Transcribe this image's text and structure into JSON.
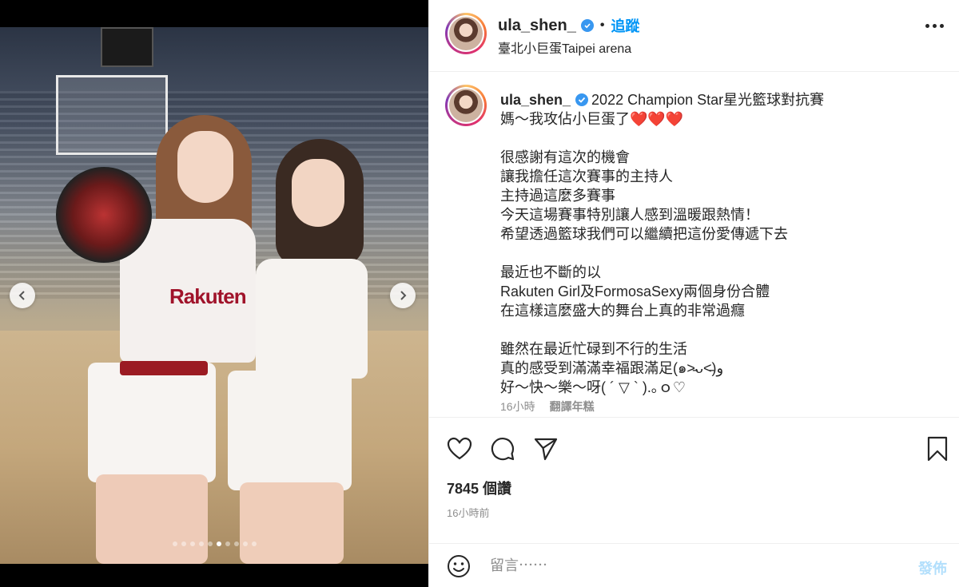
{
  "header": {
    "username": "ula_shen_",
    "separator": "•",
    "follow_label": "追蹤",
    "location": "臺北小巨蛋Taipei arena"
  },
  "media": {
    "shirt_text": "Rakuten",
    "carousel_count": 10,
    "carousel_active_index": 5
  },
  "caption": {
    "username": "ula_shen_",
    "lines": [
      "2022 Champion Star星光籃球對抗賽",
      "媽～我攻佔小巨蛋了❤️❤️❤️",
      "",
      "很感謝有這次的機會",
      "讓我擔任這次賽事的主持人",
      "主持過這麼多賽事",
      "今天這場賽事特別讓人感到溫暖跟熱情！",
      "希望透過籃球我們可以繼續把這份愛傳遞下去",
      "",
      "最近也不斷的以",
      "Rakuten Girl及FormosaSexy兩個身份合體",
      "在這樣這麼盛大的舞台上真的非常過癮",
      "",
      "雖然在最近忙碌到不行的生活",
      "真的感受到滿滿幸福跟滿足(๑˃̵ᴗ˂̵)و",
      "好～快～樂～呀( ´ ▽ ` ).｡ｏ♡"
    ],
    "time": "16小時",
    "translate_label": "翻譯年糕"
  },
  "stats": {
    "likes": "7845 個讚",
    "time_ago": "16小時前"
  },
  "comment": {
    "placeholder": "留言⋯⋯",
    "post_label": "發佈"
  },
  "colors": {
    "accent": "#0095f6",
    "post_disabled": "#b2dffc",
    "verified": "#3897f0"
  }
}
